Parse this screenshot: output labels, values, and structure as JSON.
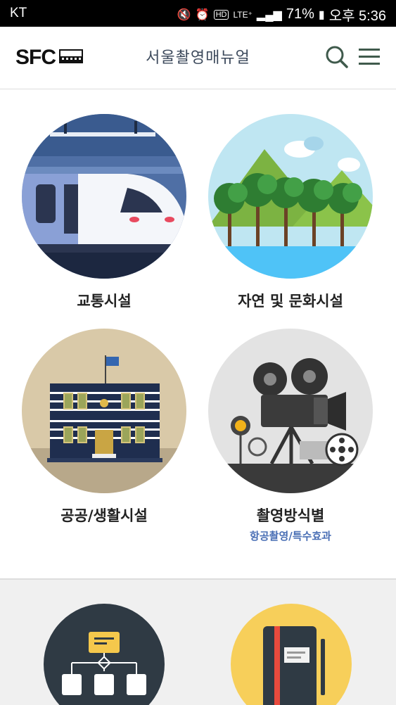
{
  "statusbar": {
    "carrier": "KT",
    "battery": "71%",
    "time": "오후 5:36",
    "icons": [
      "mute-icon",
      "alarm-icon",
      "hd-icon",
      "lte-icon",
      "signal-icon",
      "battery-icon"
    ]
  },
  "header": {
    "logo_text": "SFC",
    "title": "서울촬영매뉴얼",
    "search_icon": "search-icon",
    "menu_icon": "menu-icon"
  },
  "categories": [
    {
      "label": "교통시설",
      "image": "train"
    },
    {
      "label": "자연 및 문화시설",
      "image": "nature"
    },
    {
      "label": "공공/생활시설",
      "image": "building"
    },
    {
      "label": "촬영방식별",
      "sub": "항공촬영/특수효과",
      "image": "camera"
    }
  ],
  "more": [
    {
      "image": "org-chart-icon"
    },
    {
      "image": "notebook-icon"
    }
  ],
  "colors": {
    "title": "#3d4a5c",
    "sub_link": "#4a6fb5",
    "train_bg": "#4f6fa5",
    "nature_bg": "#bfe6f2",
    "building_bg": "#d9c9a8",
    "camera_bg": "#e3e3e3",
    "org_bg": "#2f3a44",
    "notebook_bg": "#f7cf5a"
  }
}
